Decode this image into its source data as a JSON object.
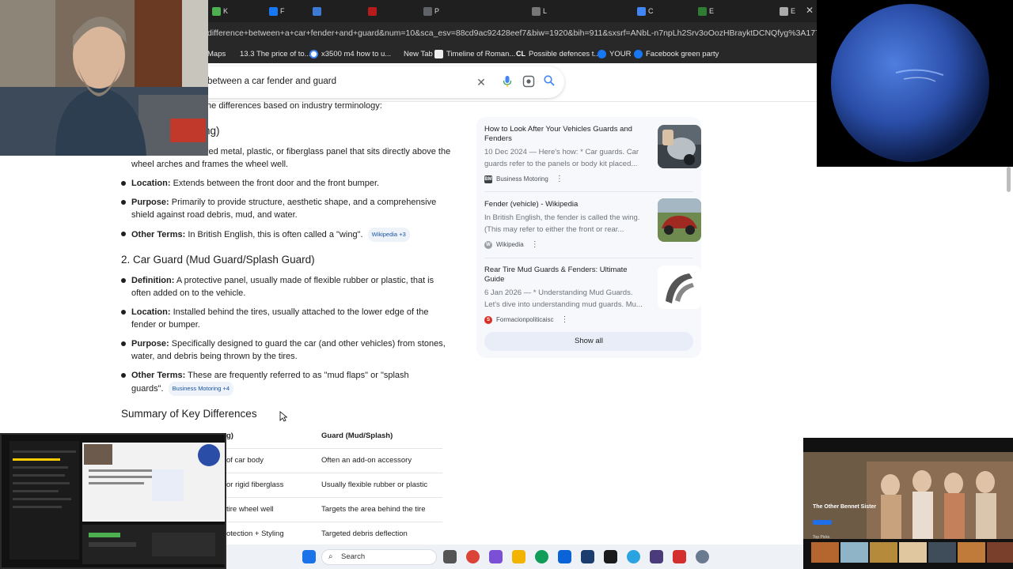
{
  "browser": {
    "url": "difference+between+a+car+fender+and+guard&num=10&sca_esv=88cd9ac92428eef7&biw=1920&bih=911&sxsrf=ANbL-n7npLh2Srv3oOozHBrayktDCNQfyg%3A1775208419797&ei=44",
    "tabs": [
      "K",
      "F",
      "P",
      "L",
      "C",
      "F",
      "E",
      "P",
      "E"
    ],
    "bookmarks": [
      "Maps",
      "13.3 The price of to...",
      "x3500 m4 how to u...",
      "New Tab",
      "Timeline of Roman...",
      "Possible defences t...",
      "YOUR",
      "Facebook green party"
    ]
  },
  "search": {
    "query": "between a car fender and guard",
    "clear_icon": "close-icon",
    "voice_icon": "mic-icon",
    "lens_icon": "camera-lens-icon",
    "search_icon": "search-icon"
  },
  "answer": {
    "intro": "the differences based on industry terminology:",
    "section1_heading_fragment": "ng)",
    "section1_def_fragment": "ved metal, plastic, or fiberglass panel that sits directly above the",
    "section1_def_cont": "wheel arches and frames the wheel well.",
    "section1_bullets": [
      {
        "label": "Location:",
        "text": "Extends between the front door and the front bumper."
      },
      {
        "label": "Purpose:",
        "text": "Primarily to provide structure, aesthetic shape, and a comprehensive shield against road debris, mud, and water."
      },
      {
        "label": "Other Terms:",
        "text": "In British English, this is often called a \"wing\".",
        "chip": "Wikipedia +3"
      }
    ],
    "section2_heading": "2. Car Guard (Mud Guard/Splash Guard)",
    "section2_bullets": [
      {
        "label": "Definition:",
        "text": "A protective panel, usually made of flexible rubber or plastic, that is often added on to the vehicle."
      },
      {
        "label": "Location:",
        "text": "Installed behind the tires, usually attached to the lower edge of the fender or bumper."
      },
      {
        "label": "Purpose:",
        "text": "Specifically designed to guard the car (and other vehicles) from stones, water, and debris being thrown by the tires."
      },
      {
        "label": "Other Terms:",
        "text": "These are frequently referred to as \"mud flaps\" or \"splash guards\".",
        "chip": "Business Motoring +4"
      }
    ],
    "summary_heading": "Summary of Key Differences"
  },
  "table": {
    "col1_header": "g)",
    "col2_header": "Guard (Mud/Splash)",
    "rows": [
      {
        "c1": "of car body",
        "c2": "Often an add-on accessory"
      },
      {
        "c1": "or rigid fiberglass",
        "c2": "Usually flexible rubber or plastic"
      },
      {
        "c1": "tire wheel well",
        "c2": "Targets the area behind the tire"
      },
      {
        "c1": "otection + Styling",
        "c2": "Targeted debris deflection"
      }
    ]
  },
  "sources": [
    {
      "title": "How to Look After Your Vehicles Guards and Fenders",
      "snippet": "10 Dec 2024 — Here's how: * Car guards. Car guards refer to the panels or body kit placed...",
      "site": "Business Motoring",
      "fav": "BM",
      "fav_color": "#3c4043"
    },
    {
      "title": "Fender (vehicle) - Wikipedia",
      "snippet": "In British English, the fender is called the wing. (This may refer to either the front or rear...",
      "site": "Wikipedia",
      "fav": "W",
      "fav_color": "#9aa0a6"
    },
    {
      "title": "Rear Tire Mud Guards & Fenders: Ultimate Guide",
      "snippet": "6 Jan 2026 — * Understanding Mud Guards. Let's dive into understanding mud guards. Mu...",
      "site": "Formacionpoliticaisc",
      "fav": "S",
      "fav_color": "#d93025"
    }
  ],
  "show_all": "Show all",
  "taskbar": {
    "search_placeholder": "Search"
  },
  "mini_right": {
    "title": "The Other Bennet Sister",
    "section": "Top Picks"
  }
}
